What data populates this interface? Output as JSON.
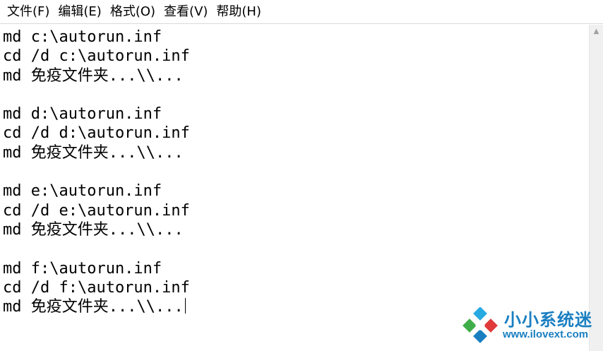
{
  "menu": {
    "items": [
      {
        "label": "文件(F)"
      },
      {
        "label": "编辑(E)"
      },
      {
        "label": "格式(O)"
      },
      {
        "label": "查看(V)"
      },
      {
        "label": "帮助(H)"
      }
    ]
  },
  "editor": {
    "lines": [
      "md c:\\autorun.inf",
      "cd /d c:\\autorun.inf",
      "md 免疫文件夹...\\\\...",
      "",
      "md d:\\autorun.inf",
      "cd /d d:\\autorun.inf",
      "md 免疫文件夹...\\\\...",
      "",
      "md e:\\autorun.inf",
      "cd /d e:\\autorun.inf",
      "md 免疫文件夹...\\\\...",
      "",
      "md f:\\autorun.inf",
      "cd /d f:\\autorun.inf",
      "md 免疫文件夹...\\\\..."
    ]
  },
  "watermark": {
    "title": "小小系统迷",
    "url": "www.ilovext.com"
  },
  "colors": {
    "watermark": "#1a7fc1",
    "logo_red": "#e03a3a",
    "logo_green": "#3fae49",
    "logo_blue": "#1a7fc1",
    "logo_cyan": "#27a9e1"
  }
}
